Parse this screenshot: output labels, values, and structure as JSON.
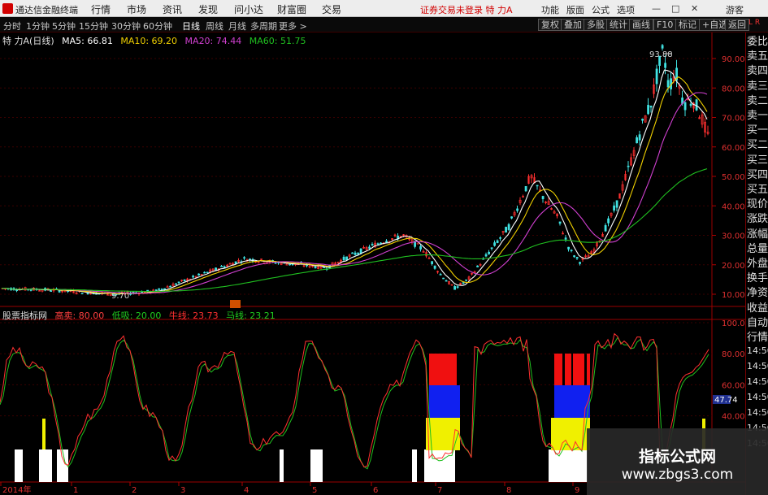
{
  "menubar": {
    "app_title": "通达信金融终端",
    "menus": [
      "行情",
      "市场",
      "资讯",
      "发现",
      "问小达",
      "财富圈",
      "交易"
    ],
    "status": "证券交易未登录  特 力A",
    "right_items": [
      "功能",
      "版面",
      "公式",
      "选项"
    ],
    "guest": "游客"
  },
  "tabbar": {
    "periods": [
      "分时",
      "1分钟",
      "5分钟",
      "15分钟",
      "30分钟",
      "60分钟",
      "日线",
      "周线",
      "月线",
      "多周期",
      "更多 >"
    ],
    "active": "日线",
    "right_buttons": [
      "复权",
      "叠加",
      "多股",
      "统计",
      "画线",
      "F10",
      "标记",
      "+自选",
      "返回"
    ]
  },
  "main_chart": {
    "stock_label": "特 力A(日线)",
    "ma5": "MA5: 66.81",
    "ma10": "MA10: 69.20",
    "ma20": "MA20: 74.44",
    "ma60": "MA60: 51.75",
    "high_label": "93.88",
    "low_label": "9.70",
    "y_axis": [
      "90.00",
      "80.00",
      "70.00",
      "60.00",
      "50.00",
      "40.00",
      "30.00",
      "20.00",
      "10.00"
    ],
    "colors": {
      "ma5": "#ffffff",
      "ma10": "#f0d000",
      "ma20": "#d040d0",
      "ma60": "#20c020",
      "up": "#ff3030",
      "down": "#40e0e0"
    }
  },
  "indicator": {
    "name": "股票指标网",
    "items": [
      {
        "text": "高卖: 80.00",
        "color": "#ff4040"
      },
      {
        "text": "低吸: 20.00",
        "color": "#20d020"
      },
      {
        "text": "牛线: 23.73",
        "color": "#ff3030"
      },
      {
        "text": "马线: 23.21",
        "color": "#20d020"
      }
    ],
    "y_axis": [
      "100.0",
      "80.00",
      "60.00",
      "40.00"
    ],
    "current_value": "47.74"
  },
  "x_axis": [
    "2014年",
    "1",
    "2",
    "3",
    "4",
    "5",
    "6",
    "7",
    "8",
    "9"
  ],
  "sidebar": {
    "items": [
      "委比",
      "卖五",
      "卖四",
      "卖三",
      "卖二",
      "卖一",
      "买一",
      "买二",
      "买三",
      "买四",
      "买五",
      "现价",
      "涨跌",
      "涨幅",
      "总量",
      "外盘",
      "换手",
      "净资",
      "收益",
      "自动",
      "行情"
    ],
    "times": [
      "14:50",
      "14:50",
      "14:50",
      "14:50",
      "14:50",
      "14:50",
      "14:50"
    ],
    "corner": "L R"
  },
  "watermark": {
    "line1": "指标公式网",
    "line2": "www.zbgs3.com"
  }
}
